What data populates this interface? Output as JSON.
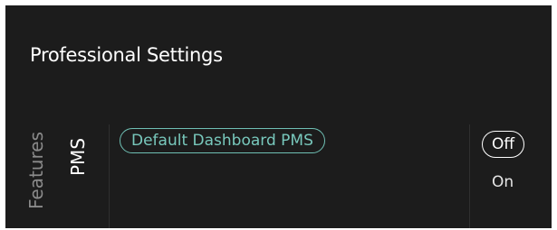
{
  "header": {
    "title": "Professional Settings"
  },
  "columns": {
    "category_label": "Features",
    "subcategory_label": "PMS"
  },
  "menu": {
    "items": [
      {
        "label": "Default Dashboard PMS",
        "state": "focused"
      }
    ]
  },
  "options": {
    "items": [
      {
        "label": "Off",
        "selected": true
      },
      {
        "label": "On",
        "selected": false
      }
    ]
  },
  "colors": {
    "background": "#1c1c1c",
    "accent": "#6fc0b4",
    "text": "#ffffff",
    "muted": "#8a8a8a"
  }
}
